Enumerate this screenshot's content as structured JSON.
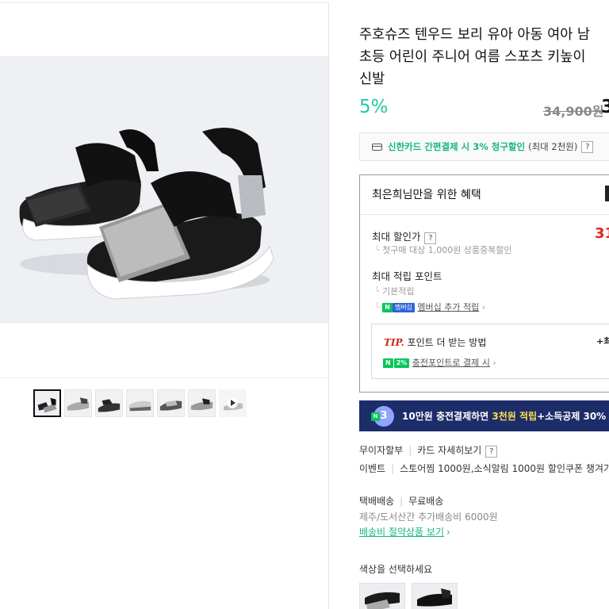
{
  "product": {
    "title_lines": [
      "주호슈즈 텐우드 보리 유아 아동 여아 남",
      "초등 어린이 주니어 여름 스포츠 키높이",
      "신발"
    ],
    "discount_rate": "5%",
    "original_price": "34,900원",
    "sale_price_partial": "3"
  },
  "card_promo": {
    "highlight": "신한카드 간편결제 시 3% 청구할인",
    "note": "(최대 2천원)",
    "help": "?"
  },
  "benefits": {
    "header": "최은희님만을 위한 혜택",
    "max_discount_label": "최대 할인가",
    "max_discount_help": "?",
    "max_discount_value_partial": "31",
    "first_purchase_note": "첫구매 대상 1,000원 상품중복할인",
    "max_points_label": "최대 적립 포인트",
    "basic_points": "기본적립",
    "membership_badge_n": "N",
    "membership_badge_text": "멤버십",
    "membership_link": "멤버십 추가 적립",
    "tip": {
      "tip_label": "TIP.",
      "title": "포인트 더 받는 방법",
      "right_partial": "+최",
      "badge_n": "N",
      "badge_pct": "2%",
      "link": "충전포인트로 결제 시"
    }
  },
  "banner": {
    "badge_n": "N",
    "badge_num": "3",
    "text_before": "10만원 충전결제하면 ",
    "highlight": "3천원 적립",
    "text_after": "+소득공제 30%"
  },
  "payment": {
    "installment": "무이자할부",
    "card_detail": "카드 자세히보기",
    "help": "?"
  },
  "event": {
    "label": "이벤트",
    "text": "스토어찜 1000원,소식알림 1000원 할인쿠폰 챙겨가"
  },
  "shipping": {
    "method": "택배배송",
    "fee": "무료배송",
    "extra": "제주/도서산간 추가배송비 6000원",
    "link": "배송비 절약상품 보기"
  },
  "options": {
    "color_prompt": "색상을 선택하세요"
  },
  "icons": {
    "card": "credit-card-icon",
    "chevron": "chevron-right-icon",
    "play": "play-icon"
  },
  "colors": {
    "accent_green": "#16b585",
    "discount_teal": "#1ec8a5",
    "price_red": "#e2231a",
    "banner_navy": "#1c2d6a",
    "banner_highlight": "#ffe04a"
  }
}
